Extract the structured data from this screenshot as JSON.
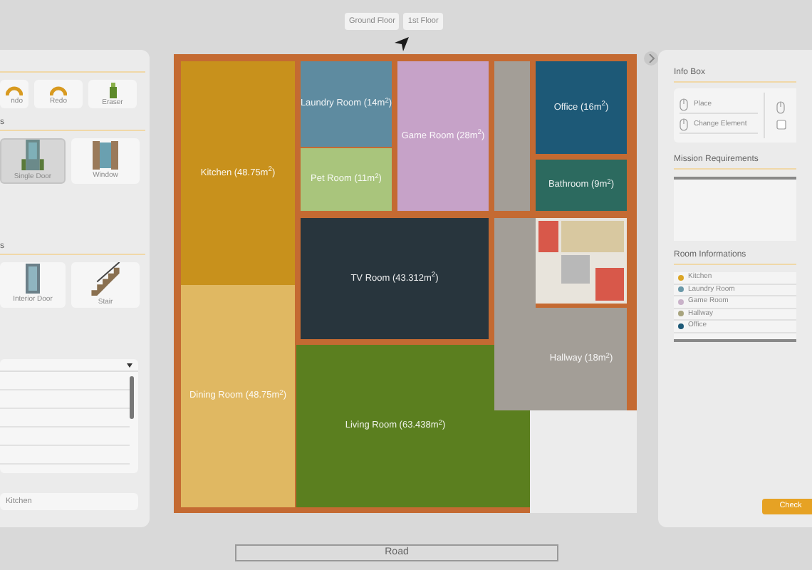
{
  "floor_tabs": [
    "Ground Floor",
    "1st Floor"
  ],
  "left_panel": {
    "actions": [
      "ndo",
      "Redo",
      "Eraser"
    ],
    "sections": [
      {
        "title": "s",
        "items": [
          {
            "label": "Single Door",
            "kind": "door",
            "selected": true
          },
          {
            "label": "Window",
            "kind": "window",
            "selected": false
          }
        ]
      },
      {
        "title": "s",
        "items": [
          {
            "label": "Interior Door",
            "kind": "interior",
            "selected": false
          },
          {
            "label": "Stair",
            "kind": "stair",
            "selected": false
          }
        ]
      }
    ],
    "selected_room": "Kitchen"
  },
  "rooms": [
    {
      "label": "Kitchen (48.75m$^{2}$)",
      "color": "#c8911c"
    },
    {
      "label": "Laundry Room (14m$^{2}$)",
      "color": "#5e8ba0"
    },
    {
      "label": "Game Room (28m$^{2}$)",
      "color": "#c6a2c8"
    },
    {
      "label": "Office (16m$^{2}$)",
      "color": "#1d5977"
    },
    {
      "label": "Pet Room (11m$^{2}$)",
      "color": "#a9c57c"
    },
    {
      "label": "Bathroom (9m$^{2}$)",
      "color": "#2c6a5f"
    },
    {
      "label": "TV Room (43.312m$^{2}$)",
      "color": "#28353d"
    },
    {
      "label": "Hallway (18m$^{2}$)",
      "color": "#a39e97"
    },
    {
      "label": "Dining Room (48.75m$^{2}$)",
      "color": "#e0b862"
    },
    {
      "label": "Living Room (63.438m$^{2}$)",
      "color": "#5b7f1f"
    }
  ],
  "road": "Road",
  "right_panel": {
    "info_title": "Info Box",
    "controls": [
      "Place",
      "Change Element"
    ],
    "mission_title": "Mission Requirements",
    "rooms_title": "Room Informations",
    "room_list": [
      {
        "name": "Kitchen",
        "color": "#dba526"
      },
      {
        "name": "Laundry Room",
        "color": "#6a98a8"
      },
      {
        "name": "Game Room",
        "color": "#c9b2c9"
      },
      {
        "name": "Hallway",
        "color": "#a8a47e"
      },
      {
        "name": "Office",
        "color": "#1d5977"
      }
    ],
    "check_button": "Check"
  }
}
